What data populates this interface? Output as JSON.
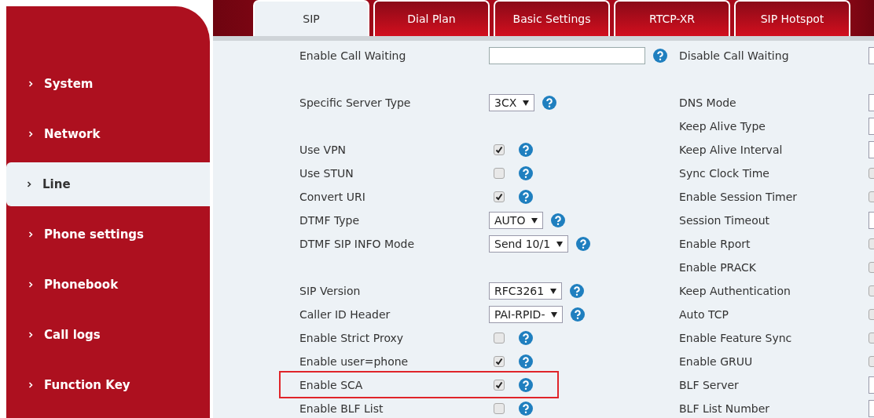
{
  "sidebar": {
    "items": [
      {
        "label": "System",
        "selected": false
      },
      {
        "label": "Network",
        "selected": false
      },
      {
        "label": "Line",
        "selected": true
      },
      {
        "label": "Phone settings",
        "selected": false
      },
      {
        "label": "Phonebook",
        "selected": false
      },
      {
        "label": "Call logs",
        "selected": false
      },
      {
        "label": "Function Key",
        "selected": false
      }
    ]
  },
  "tabs": [
    {
      "label": "SIP",
      "selected": true
    },
    {
      "label": "Dial Plan",
      "selected": false
    },
    {
      "label": "Basic Settings",
      "selected": false
    },
    {
      "label": "RTCP-XR",
      "selected": false
    },
    {
      "label": "SIP Hotspot",
      "selected": false
    }
  ],
  "rows": [
    {
      "left": {
        "label": "Enable Call Waiting",
        "kind": "text"
      },
      "right": {
        "label": "Disable Call Waiting",
        "kind": "field"
      }
    },
    {},
    {
      "left": {
        "label": "Specific Server Type",
        "kind": "select",
        "value": "3CX"
      },
      "right": {
        "label": "DNS Mode",
        "kind": "field"
      }
    },
    {
      "right": {
        "label": "Keep Alive Type",
        "kind": "field"
      }
    },
    {
      "left": {
        "label": "Use VPN",
        "kind": "checkbox",
        "checked": true
      },
      "right": {
        "label": "Keep Alive Interval",
        "kind": "field"
      }
    },
    {
      "left": {
        "label": "Use STUN",
        "kind": "checkbox",
        "checked": false
      },
      "right": {
        "label": "Sync Clock Time",
        "kind": "checkbox",
        "checked": false
      }
    },
    {
      "left": {
        "label": "Convert URI",
        "kind": "checkbox",
        "checked": true
      },
      "right": {
        "label": "Enable Session Timer",
        "kind": "checkbox",
        "checked": false
      }
    },
    {
      "left": {
        "label": "DTMF Type",
        "kind": "select",
        "value": "AUTO"
      },
      "right": {
        "label": "Session Timeout",
        "kind": "field"
      }
    },
    {
      "left": {
        "label": "DTMF SIP INFO Mode",
        "kind": "select",
        "value": "Send 10/1"
      },
      "right": {
        "label": "Enable Rport",
        "kind": "checkbox",
        "checked": false
      }
    },
    {
      "right": {
        "label": "Enable PRACK",
        "kind": "checkbox",
        "checked": false
      }
    },
    {
      "left": {
        "label": "SIP Version",
        "kind": "select",
        "value": "RFC3261"
      },
      "right": {
        "label": "Keep Authentication",
        "kind": "checkbox",
        "checked": false
      }
    },
    {
      "left": {
        "label": "Caller ID Header",
        "kind": "select",
        "value": "PAI-RPID-"
      },
      "right": {
        "label": "Auto TCP",
        "kind": "checkbox",
        "checked": false
      }
    },
    {
      "left": {
        "label": "Enable Strict Proxy",
        "kind": "checkbox",
        "checked": false
      },
      "right": {
        "label": "Enable Feature Sync",
        "kind": "checkbox",
        "checked": false
      }
    },
    {
      "left": {
        "label": "Enable user=phone",
        "kind": "checkbox",
        "checked": true
      },
      "right": {
        "label": "Enable GRUU",
        "kind": "checkbox",
        "checked": false
      }
    },
    {
      "left": {
        "label": "Enable SCA",
        "kind": "checkbox",
        "checked": true,
        "highlighted": true
      },
      "right": {
        "label": "BLF Server",
        "kind": "field"
      }
    },
    {
      "left": {
        "label": "Enable BLF List",
        "kind": "checkbox",
        "checked": false
      },
      "right": {
        "label": "BLF List Number",
        "kind": "field"
      }
    }
  ]
}
